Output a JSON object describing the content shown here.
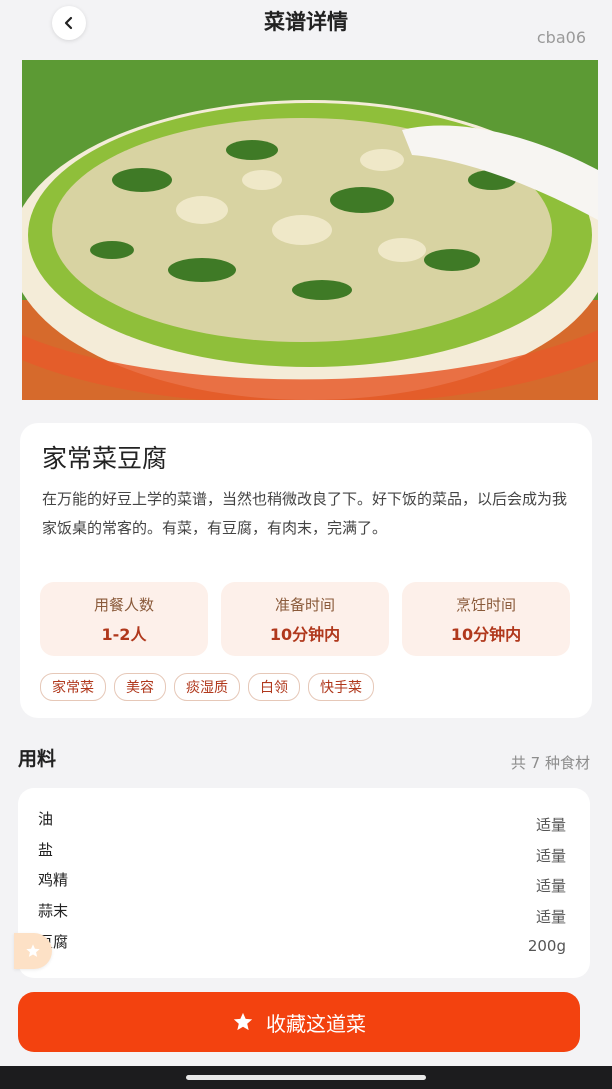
{
  "header": {
    "title": "菜谱详情",
    "user_id": "cba06"
  },
  "recipe": {
    "name": "家常菜豆腐",
    "description": "在万能的好豆上学的菜谱，当然也稍微改良了下。好下饭的菜品，以后会成为我家饭桌的常客的。有菜，有豆腐，有肉末，完满了。",
    "stats": [
      {
        "label": "用餐人数",
        "value": "1-2人"
      },
      {
        "label": "准备时间",
        "value": "10分钟内"
      },
      {
        "label": "烹饪时间",
        "value": "10分钟内"
      }
    ],
    "tags": [
      "家常菜",
      "美容",
      "痰湿质",
      "白领",
      "快手菜"
    ]
  },
  "ingredients": {
    "title": "用料",
    "count_label": "共 7 种食材",
    "items": [
      {
        "name": "油",
        "qty": "适量"
      },
      {
        "name": "盐",
        "qty": "适量"
      },
      {
        "name": "鸡精",
        "qty": "适量"
      },
      {
        "name": "蒜末",
        "qty": "适量"
      },
      {
        "name": "豆腐",
        "qty": "200g"
      }
    ]
  },
  "footer": {
    "collect_label": "收藏这道菜"
  },
  "colors": {
    "accent": "#f3420f",
    "tag_text": "#b0381c",
    "stat_bg": "#fdf0ea"
  },
  "icons": {
    "back": "chevron-left-icon",
    "collect": "star-icon",
    "float": "star-badge-icon"
  }
}
